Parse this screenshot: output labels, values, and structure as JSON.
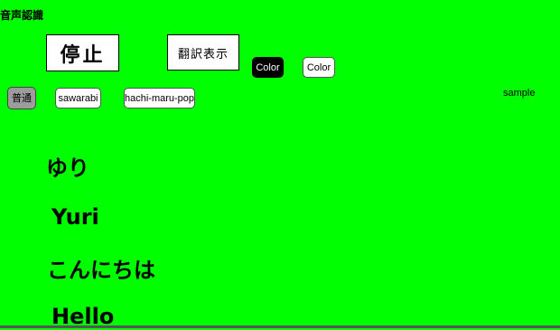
{
  "app": {
    "title": "音声認識"
  },
  "controls": {
    "stop_label": "停止",
    "translate_label": "翻訳表示",
    "color_buttons": [
      {
        "label": "Color",
        "background": "#000000",
        "text_color": "#ffffff"
      },
      {
        "label": "Color",
        "background": "#ffffff",
        "text_color": "#000000"
      }
    ],
    "font_options": [
      {
        "label": "普通",
        "selected": true
      },
      {
        "label": "sawarabi",
        "selected": false
      },
      {
        "label": "hachi-maru-pop",
        "selected": false
      }
    ],
    "sample_label": "sample"
  },
  "transcript": {
    "lines": [
      {
        "text": "ゆり",
        "kind": "original"
      },
      {
        "text": "Yuri",
        "kind": "translation"
      },
      {
        "text": "こんにちは",
        "kind": "original"
      },
      {
        "text": "Hello",
        "kind": "translation"
      }
    ]
  },
  "colors": {
    "background": "#00ff00",
    "text": "#000000"
  }
}
